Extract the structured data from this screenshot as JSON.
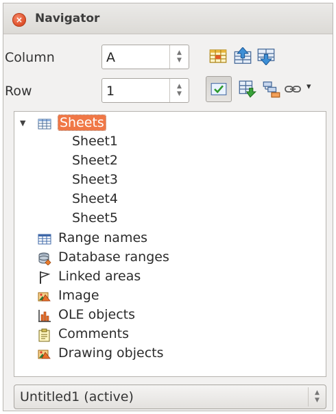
{
  "window": {
    "title": "Navigator",
    "close_glyph": "×"
  },
  "fields": {
    "column": {
      "label": "Column",
      "value": "A"
    },
    "row": {
      "label": "Row",
      "value": "1"
    }
  },
  "toolbar": {
    "icons": [
      "data-range-icon",
      "start-icon",
      "end-icon",
      "contents-toggle-icon",
      "scenarios-icon",
      "drag-mode-icon",
      "insert-as-link-icon"
    ],
    "dropdown_glyph": "▾"
  },
  "tree": {
    "root": {
      "label": "Sheets",
      "expanded": true
    },
    "sheets": [
      "Sheet1",
      "Sheet2",
      "Sheet3",
      "Sheet4",
      "Sheet5"
    ],
    "categories": [
      {
        "label": "Range names",
        "icon": "range-names-icon"
      },
      {
        "label": "Database ranges",
        "icon": "database-ranges-icon"
      },
      {
        "label": "Linked areas",
        "icon": "linked-areas-icon"
      },
      {
        "label": "Image",
        "icon": "image-icon"
      },
      {
        "label": "OLE objects",
        "icon": "ole-objects-icon"
      },
      {
        "label": "Comments",
        "icon": "comments-icon"
      },
      {
        "label": "Drawing objects",
        "icon": "drawing-objects-icon"
      }
    ]
  },
  "document_select": {
    "value": "Untitled1 (active)"
  },
  "colors": {
    "selection": "#f07746",
    "close": "#e0522d"
  }
}
